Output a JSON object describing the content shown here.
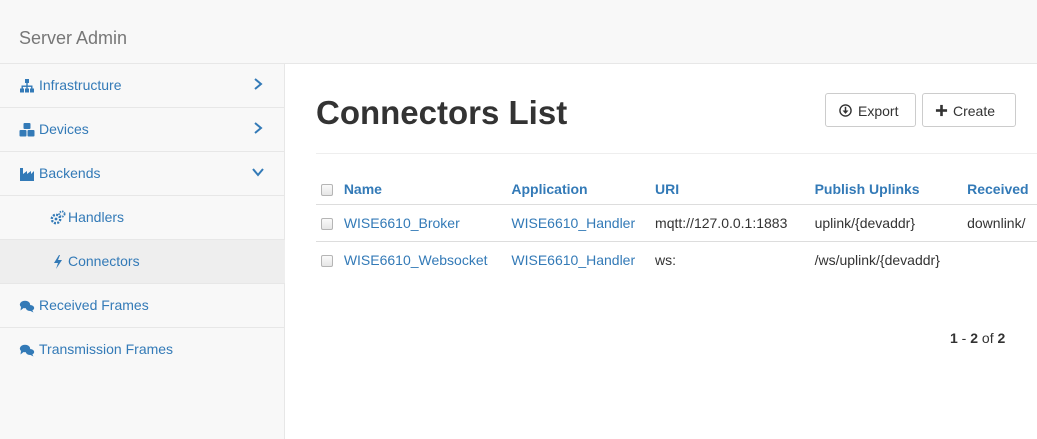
{
  "app": {
    "title": "Server Admin"
  },
  "sidebar": {
    "items": [
      {
        "label": "Infrastructure",
        "icon": "sitemap-icon",
        "expanded": false
      },
      {
        "label": "Devices",
        "icon": "cubes-icon",
        "expanded": false
      },
      {
        "label": "Backends",
        "icon": "industry-icon",
        "expanded": true
      },
      {
        "label": "Handlers",
        "icon": "cogs-icon"
      },
      {
        "label": "Connectors",
        "icon": "bolt-icon",
        "active": true
      },
      {
        "label": "Received Frames",
        "icon": "comments-icon"
      },
      {
        "label": "Transmission Frames",
        "icon": "comments-icon"
      }
    ]
  },
  "main": {
    "title": "Connectors List",
    "export_label": "Export",
    "create_label": "Create",
    "table": {
      "columns": [
        "Name",
        "Application",
        "URI",
        "Publish Uplinks",
        "Received"
      ],
      "rows": [
        [
          "WISE6610_Broker",
          "WISE6610_Handler",
          "mqtt://127.0.0.1:1883",
          "uplink/{devaddr}",
          "downlink/"
        ],
        [
          "WISE6610_Websocket",
          "WISE6610_Handler",
          "ws:",
          "/ws/uplink/{devaddr}",
          ""
        ]
      ]
    },
    "pager": {
      "start": "1",
      "end": "2",
      "total": "2",
      "sep": " - ",
      "of": " of "
    }
  },
  "colors": {
    "link": "#337ab7",
    "sidebar_bg": "#f8f8f8",
    "active_bg": "#eeeeee"
  }
}
